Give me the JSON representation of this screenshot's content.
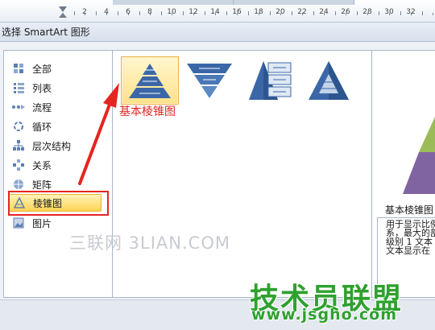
{
  "ruler": {
    "numbers": [
      "2",
      "4",
      "6",
      "8",
      "10",
      "12",
      "14",
      "16",
      "18",
      "20",
      "22",
      "24",
      "26",
      "28",
      "30",
      "32"
    ]
  },
  "dialog": {
    "title": "选择 SmartArt 图形"
  },
  "categories": [
    {
      "label": "全部",
      "icon": "all-icon"
    },
    {
      "label": "列表",
      "icon": "list-icon"
    },
    {
      "label": "流程",
      "icon": "process-icon"
    },
    {
      "label": "循环",
      "icon": "cycle-icon"
    },
    {
      "label": "层次结构",
      "icon": "hierarchy-icon"
    },
    {
      "label": "关系",
      "icon": "relationship-icon"
    },
    {
      "label": "矩阵",
      "icon": "matrix-icon"
    },
    {
      "label": "棱锥图",
      "icon": "pyramid-icon",
      "selected": true
    },
    {
      "label": "图片",
      "icon": "picture-icon"
    }
  ],
  "gallery": {
    "selected_label": "基本棱锥图"
  },
  "preview": {
    "title": "基本棱锥图",
    "lines": [
      "用于显示比例",
      "系，最大的部",
      "级别 1 文本",
      "文本显示在"
    ]
  },
  "watermarks": {
    "site": "三联网 3LIAN.COM",
    "brand": "技术员联盟",
    "url": "www.jsgho.com"
  },
  "colors": {
    "accent_red": "#e52521",
    "pyramid_blue": "#3b67a8",
    "pyramid_green": "#9bbb59",
    "pyramid_purple": "#8064a2",
    "brand_green": "#2ea12e"
  }
}
